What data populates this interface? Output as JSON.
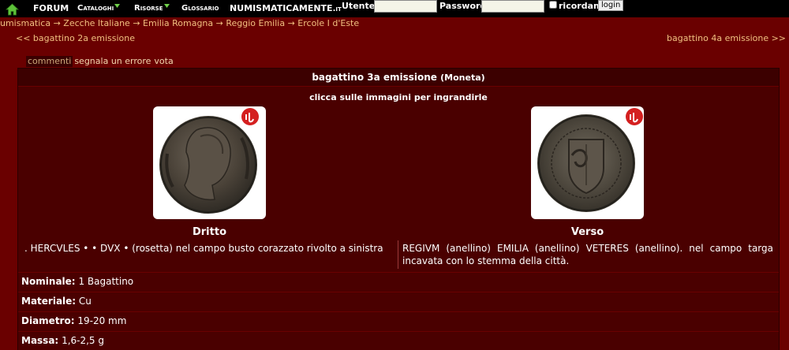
{
  "nav": {
    "forum": "FORUM",
    "cataloghi": "Cataloghi",
    "risorse": "Risorse",
    "glossario": "Glossario",
    "site_main": "NUMISMATICAMENTE",
    "site_tld": ".it"
  },
  "login": {
    "user_label": "Utente:",
    "password_label": "Password:",
    "remember_label": "ricordami",
    "button_label": "login"
  },
  "breadcrumb": "umismatica → Zecche Italiane → Emilia Romagna → Reggio Emilia → Ercole I d'Este",
  "pager": {
    "prev": "<< bagattino 2a emissione",
    "next": "bagattino 4a emissione >>"
  },
  "tabs": [
    "commenti",
    "segnala un errore",
    "vota"
  ],
  "coin": {
    "title": "bagattino 3a emissione",
    "kind": "(Moneta)",
    "hint": "clicca sulle immagini per ingrandirle",
    "obverse_label": "Dritto",
    "reverse_label": "Verso",
    "obverse_legend": ". HERCVLES • • DVX • (rosetta) nel campo busto corazzato rivolto a sinistra",
    "reverse_legend": "REGIVM (anellino) EMILIA (anellino) VETERES (anellino). nel campo targa incavata con lo stemma della città."
  },
  "details": [
    {
      "label": "Nominale:",
      "value": "1 Bagattino"
    },
    {
      "label": "Materiale:",
      "value": "Cu"
    },
    {
      "label": "Diametro:",
      "value": "19-20 mm"
    },
    {
      "label": "Massa:",
      "value": "1,6-2,5 g"
    }
  ],
  "colors": {
    "background": "#6a0000",
    "panel": "#4a0000",
    "link": "#f0c080",
    "topbar": "#000000",
    "badge_red": "#d42020"
  },
  "icons": [
    "home-icon",
    "chevron-down-icon",
    "lamoneta-badge-icon"
  ]
}
